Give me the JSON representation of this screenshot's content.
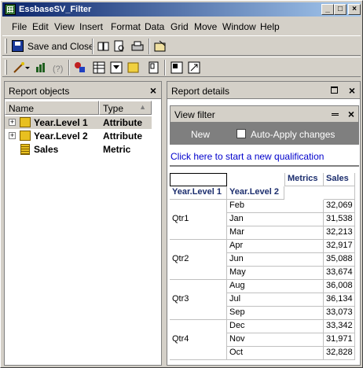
{
  "window": {
    "title": "EssbaseSV_Filter"
  },
  "menu": [
    "File",
    "Edit",
    "View",
    "Insert",
    "Format",
    "Data",
    "Grid",
    "Move",
    "Window",
    "Help"
  ],
  "toolbar": {
    "save_label": "Save and Close"
  },
  "report_objects": {
    "title": "Report objects",
    "col_name": "Name",
    "col_type": "Type",
    "items": [
      {
        "name": "Year.Level 1",
        "type": "Attribute"
      },
      {
        "name": "Year.Level 2",
        "type": "Attribute"
      },
      {
        "name": "Sales",
        "type": "Metric"
      }
    ]
  },
  "report_details": {
    "title": "Report details"
  },
  "view_filter": {
    "title": "View filter",
    "new_label": "New",
    "auto_apply_label": "Auto-Apply changes",
    "qualification_link": "Click here to start a new qualification"
  },
  "grid": {
    "metrics_header": "Metrics",
    "col1_header": "Year.Level 1",
    "col2_header": "Year.Level 2",
    "sales_header": "Sales",
    "groups": [
      {
        "label": "Qtr1",
        "rows": [
          {
            "m": "Feb",
            "v": "32,069"
          },
          {
            "m": "Jan",
            "v": "31,538"
          },
          {
            "m": "Mar",
            "v": "32,213"
          }
        ]
      },
      {
        "label": "Qtr2",
        "rows": [
          {
            "m": "Apr",
            "v": "32,917"
          },
          {
            "m": "Jun",
            "v": "35,088"
          },
          {
            "m": "May",
            "v": "33,674"
          }
        ]
      },
      {
        "label": "Qtr3",
        "rows": [
          {
            "m": "Aug",
            "v": "36,008"
          },
          {
            "m": "Jul",
            "v": "36,134"
          },
          {
            "m": "Sep",
            "v": "33,073"
          }
        ]
      },
      {
        "label": "Qtr4",
        "rows": [
          {
            "m": "Dec",
            "v": "33,342"
          },
          {
            "m": "Nov",
            "v": "31,971"
          },
          {
            "m": "Oct",
            "v": "32,828"
          }
        ]
      }
    ]
  }
}
